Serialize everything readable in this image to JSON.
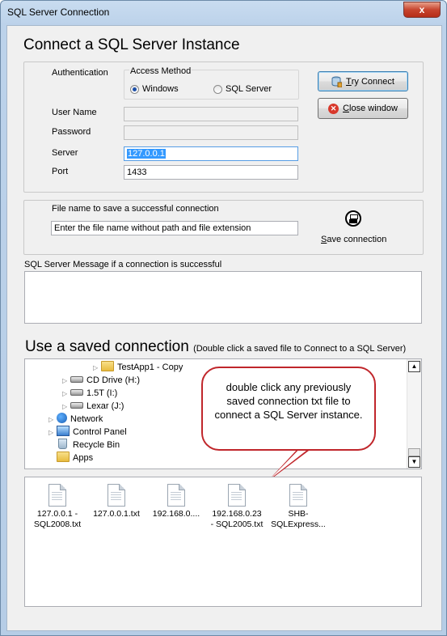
{
  "window": {
    "title": "SQL Server Connection",
    "close_glyph": "x"
  },
  "connect_section": {
    "heading": "Connect a SQL Server Instance",
    "authentication_label": "Authentication",
    "access_method": {
      "legend": "Access Method",
      "options": [
        {
          "label": "Windows",
          "selected": true
        },
        {
          "label": "SQL Server",
          "selected": false
        }
      ]
    },
    "fields": {
      "user_name": {
        "label": "User Name",
        "value": ""
      },
      "password": {
        "label": "Password",
        "value": ""
      },
      "server": {
        "label": "Server",
        "value": "127.0.0.1"
      },
      "port": {
        "label": "Port",
        "value": "1433"
      }
    },
    "buttons": {
      "try_connect": "Try Connect",
      "try_connect_mnemonic": "T",
      "close_window": "Close window",
      "close_window_mnemonic": "C"
    }
  },
  "save_section": {
    "label": "File name to save a successful connection",
    "filename_value": "Enter the file name without path and file extension",
    "save_button": "Save connection",
    "save_mnemonic": "S"
  },
  "message_section": {
    "label": "SQL Server Message if a connection is successful",
    "message": ""
  },
  "saved_section": {
    "heading": "Use a saved connection",
    "subheading": "(Double click a saved file to Connect to a SQL Server)",
    "tree": [
      {
        "label": "TestApp1 - Copy",
        "icon": "folder-icon",
        "expander": "▷"
      },
      {
        "label": "CD Drive (H:)",
        "icon": "cd-drive-icon",
        "expander": "▷"
      },
      {
        "label": "1.5T (I:)",
        "icon": "drive-icon",
        "expander": "▷"
      },
      {
        "label": "Lexar (J:)",
        "icon": "drive-icon",
        "expander": "▷"
      },
      {
        "label": "Network",
        "icon": "network-icon",
        "expander": "▷"
      },
      {
        "label": "Control Panel",
        "icon": "control-panel-icon",
        "expander": "▷"
      },
      {
        "label": "Recycle Bin",
        "icon": "recycle-bin-icon",
        "expander": ""
      },
      {
        "label": "Apps",
        "icon": "folder-icon",
        "expander": ""
      }
    ],
    "files": [
      {
        "line1": "127.0.0.1 -",
        "line2": "SQL2008.txt"
      },
      {
        "line1": "127.0.0.1.txt",
        "line2": ""
      },
      {
        "line1": "192.168.0....",
        "line2": ""
      },
      {
        "line1": "192.168.0.23",
        "line2": "- SQL2005.txt"
      },
      {
        "line1": "SHB-",
        "line2": "SQLExpress..."
      }
    ]
  },
  "callout": {
    "text": "double click any previously saved connection txt file to connect a SQL Server instance."
  },
  "colors": {
    "callout_border": "#c0262b",
    "selection": "#3399ff"
  }
}
